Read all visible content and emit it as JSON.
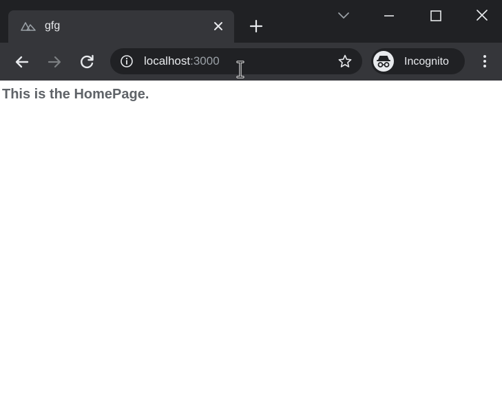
{
  "browser": {
    "tab": {
      "title": "gfg",
      "favicon": "nuxt-logo-icon"
    },
    "toolbar": {
      "address": {
        "host": "localhost",
        "port": ":3000"
      },
      "profile_label": "Incognito"
    },
    "icons": {
      "back": "arrow-left-icon",
      "forward": "arrow-right-icon",
      "reload": "reload-icon",
      "info": "info-icon",
      "bookmark": "star-icon",
      "menu": "kebab-menu-icon",
      "new_tab": "plus-icon",
      "tab_search": "chevron-down-icon",
      "minimize": "minimize-icon",
      "maximize": "maximize-icon",
      "close": "close-icon"
    },
    "colors": {
      "tabstrip": "#202124",
      "toolbar": "#35363a",
      "omnibox": "#202124",
      "text_light": "#e8eaed",
      "text_dim": "#9aa0a6",
      "page_bg": "#ffffff",
      "heading": "#5f6368"
    }
  },
  "page": {
    "heading": "This is the HomePage."
  }
}
